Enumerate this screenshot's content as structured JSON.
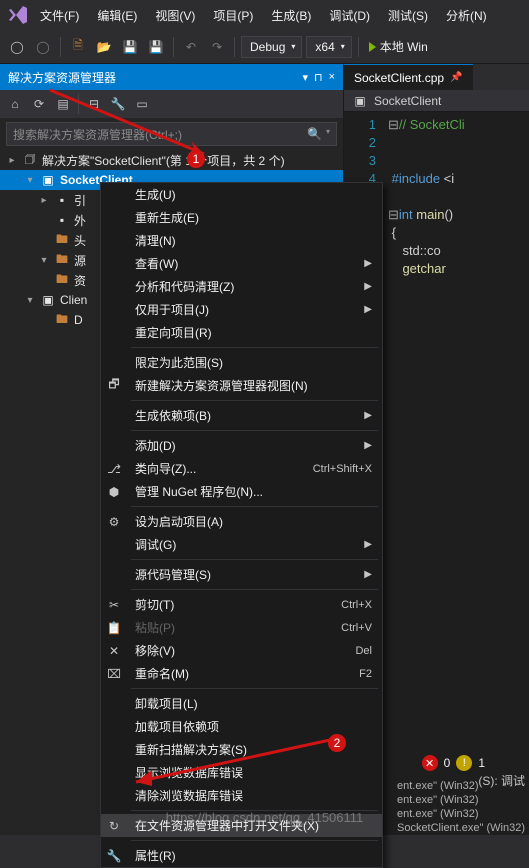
{
  "menubar": {
    "items": [
      "文件(F)",
      "编辑(E)",
      "视图(V)",
      "项目(P)",
      "生成(B)",
      "调试(D)",
      "测试(S)",
      "分析(N)"
    ]
  },
  "toolbar": {
    "config": "Debug",
    "platform": "x64",
    "start": "本地 Win"
  },
  "solution_explorer": {
    "title": "解决方案资源管理器",
    "search_placeholder": "搜索解决方案资源管理器(Ctrl+;)",
    "solution_text": "解决方案\"SocketClient\"(第 1 个项目，共 2 个)",
    "project": "SocketClient",
    "nodes": [
      "引",
      "外",
      "头",
      "源",
      "资"
    ],
    "client_node": "Clien",
    "client_child": "D"
  },
  "editor": {
    "tab": "SocketClient.cpp",
    "crumb": "SocketClient",
    "code": {
      "l1": "// SocketCli",
      "l2": "",
      "l3": "",
      "l4": "#include <i",
      "l5": "",
      "l6": "int main()",
      "l7": "{",
      "l8": "    std::co",
      "l9": "    getchar",
      "kw_int": "int",
      "fn_main": " main",
      "punc": "()",
      "include": "#include ",
      "inc_tail": "<i"
    },
    "gutter": [
      "1",
      "2",
      "3",
      "4"
    ]
  },
  "context_menu": [
    {
      "type": "item",
      "label": "生成(U)"
    },
    {
      "type": "item",
      "label": "重新生成(E)"
    },
    {
      "type": "item",
      "label": "清理(N)"
    },
    {
      "type": "item",
      "label": "查看(W)",
      "sub": true
    },
    {
      "type": "item",
      "label": "分析和代码清理(Z)",
      "sub": true
    },
    {
      "type": "item",
      "label": "仅用于项目(J)",
      "sub": true
    },
    {
      "type": "item",
      "label": "重定向项目(R)"
    },
    {
      "type": "sep"
    },
    {
      "type": "item",
      "label": "限定为此范围(S)"
    },
    {
      "type": "item",
      "label": "新建解决方案资源管理器视图(N)",
      "icon": "new-view"
    },
    {
      "type": "sep"
    },
    {
      "type": "item",
      "label": "生成依赖项(B)",
      "sub": true
    },
    {
      "type": "sep"
    },
    {
      "type": "item",
      "label": "添加(D)",
      "sub": true
    },
    {
      "type": "item",
      "label": "类向导(Z)...",
      "shortcut": "Ctrl+Shift+X",
      "icon": "wizard"
    },
    {
      "type": "item",
      "label": "管理 NuGet 程序包(N)...",
      "icon": "nuget"
    },
    {
      "type": "sep"
    },
    {
      "type": "item",
      "label": "设为启动项目(A)",
      "icon": "startup"
    },
    {
      "type": "item",
      "label": "调试(G)",
      "sub": true
    },
    {
      "type": "sep"
    },
    {
      "type": "item",
      "label": "源代码管理(S)",
      "sub": true
    },
    {
      "type": "sep"
    },
    {
      "type": "item",
      "label": "剪切(T)",
      "shortcut": "Ctrl+X",
      "icon": "cut"
    },
    {
      "type": "item",
      "label": "粘贴(P)",
      "shortcut": "Ctrl+V",
      "icon": "paste",
      "disabled": true
    },
    {
      "type": "item",
      "label": "移除(V)",
      "shortcut": "Del",
      "icon": "remove"
    },
    {
      "type": "item",
      "label": "重命名(M)",
      "shortcut": "F2",
      "icon": "rename"
    },
    {
      "type": "sep"
    },
    {
      "type": "item",
      "label": "卸载项目(L)"
    },
    {
      "type": "item",
      "label": "加载项目依赖项"
    },
    {
      "type": "item",
      "label": "重新扫描解决方案(S)"
    },
    {
      "type": "item",
      "label": "显示浏览数据库错误"
    },
    {
      "type": "item",
      "label": "清除浏览数据库错误"
    },
    {
      "type": "sep"
    },
    {
      "type": "item",
      "label": "在文件资源管理器中打开文件夹(X)",
      "icon": "open-folder",
      "hover": true
    },
    {
      "type": "sep"
    },
    {
      "type": "item",
      "label": "属性(R)",
      "icon": "props"
    }
  ],
  "errors": {
    "err": "0",
    "warn": "1"
  },
  "output": {
    "label": "(S):  调试",
    "lines": [
      "ent.exe\" (Win32)",
      "ent.exe\" (Win32)",
      "ent.exe\" (Win32)",
      "SocketClient.exe\" (Win32)"
    ]
  },
  "annotations": {
    "b1": "1",
    "b2": "2"
  },
  "watermark": "https://blog.csdn.net/qq_41506111"
}
